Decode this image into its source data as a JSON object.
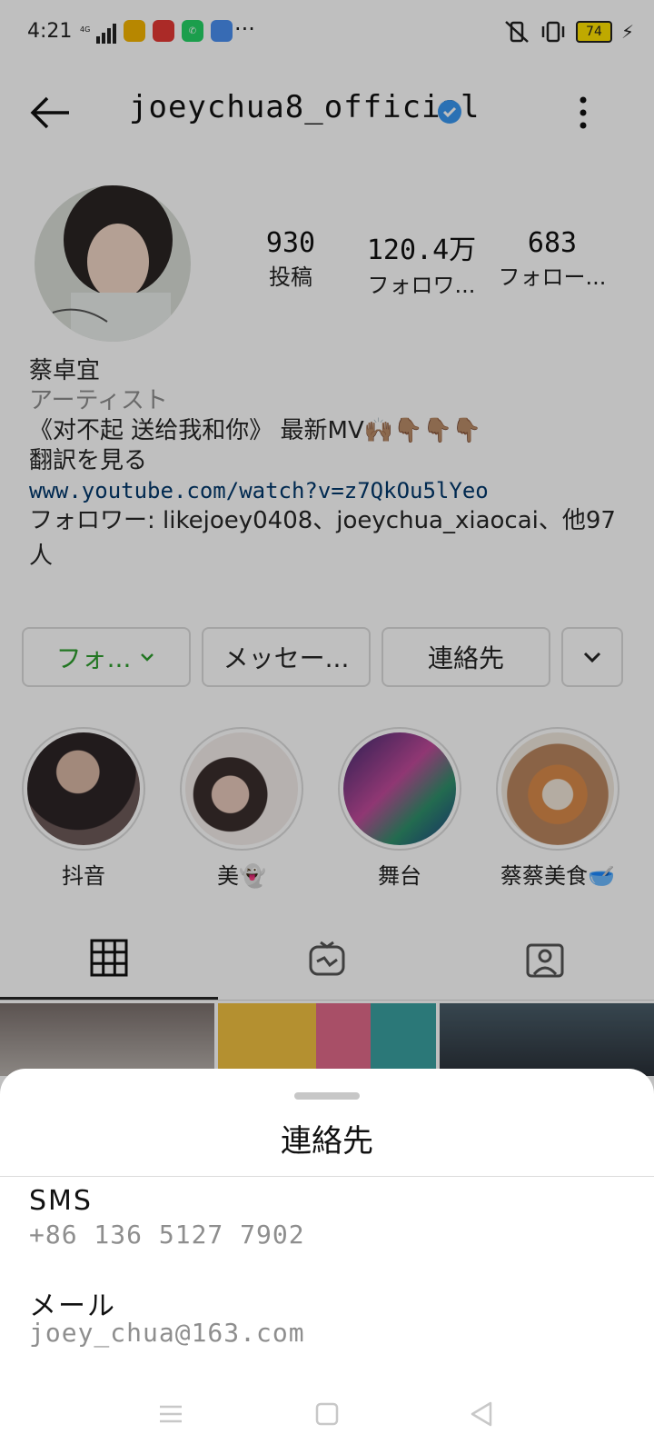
{
  "status_bar": {
    "time": "4:21",
    "network": "4G",
    "more": "···",
    "battery": "74"
  },
  "header": {
    "username": "joeychua8_official",
    "verified_color": "#3897f0"
  },
  "stats": [
    {
      "value": "930",
      "label": "投稿"
    },
    {
      "value": "120.4万",
      "label": "フォロワ..."
    },
    {
      "value": "683",
      "label": "フォロー..."
    }
  ],
  "bio": {
    "name": "蔡卓宜",
    "category": "アーティスト",
    "text": "《对不起 送给我和你》 最新MV🙌🏽👇🏽👇🏽👇🏽",
    "translate": "翻訳を見る",
    "link": "www.youtube.com/watch?v=z7QkOu5lYeo",
    "followers_line1": "フォロワー: likejoey0408、joeychua_xiaocai、他97",
    "followers_line2": "人"
  },
  "buttons": {
    "follow": "フォ...",
    "message": "メッセー...",
    "contact": "連絡先"
  },
  "highlights": [
    {
      "label": "抖音"
    },
    {
      "label": "美👻"
    },
    {
      "label": "舞台"
    },
    {
      "label": "蔡蔡美食🥣"
    }
  ],
  "sheet": {
    "title": "連絡先",
    "sms_label": "SMS",
    "sms_value": "+86 136 5127 7902",
    "mail_label": "メール",
    "mail_value": "joey_chua@163.com"
  }
}
